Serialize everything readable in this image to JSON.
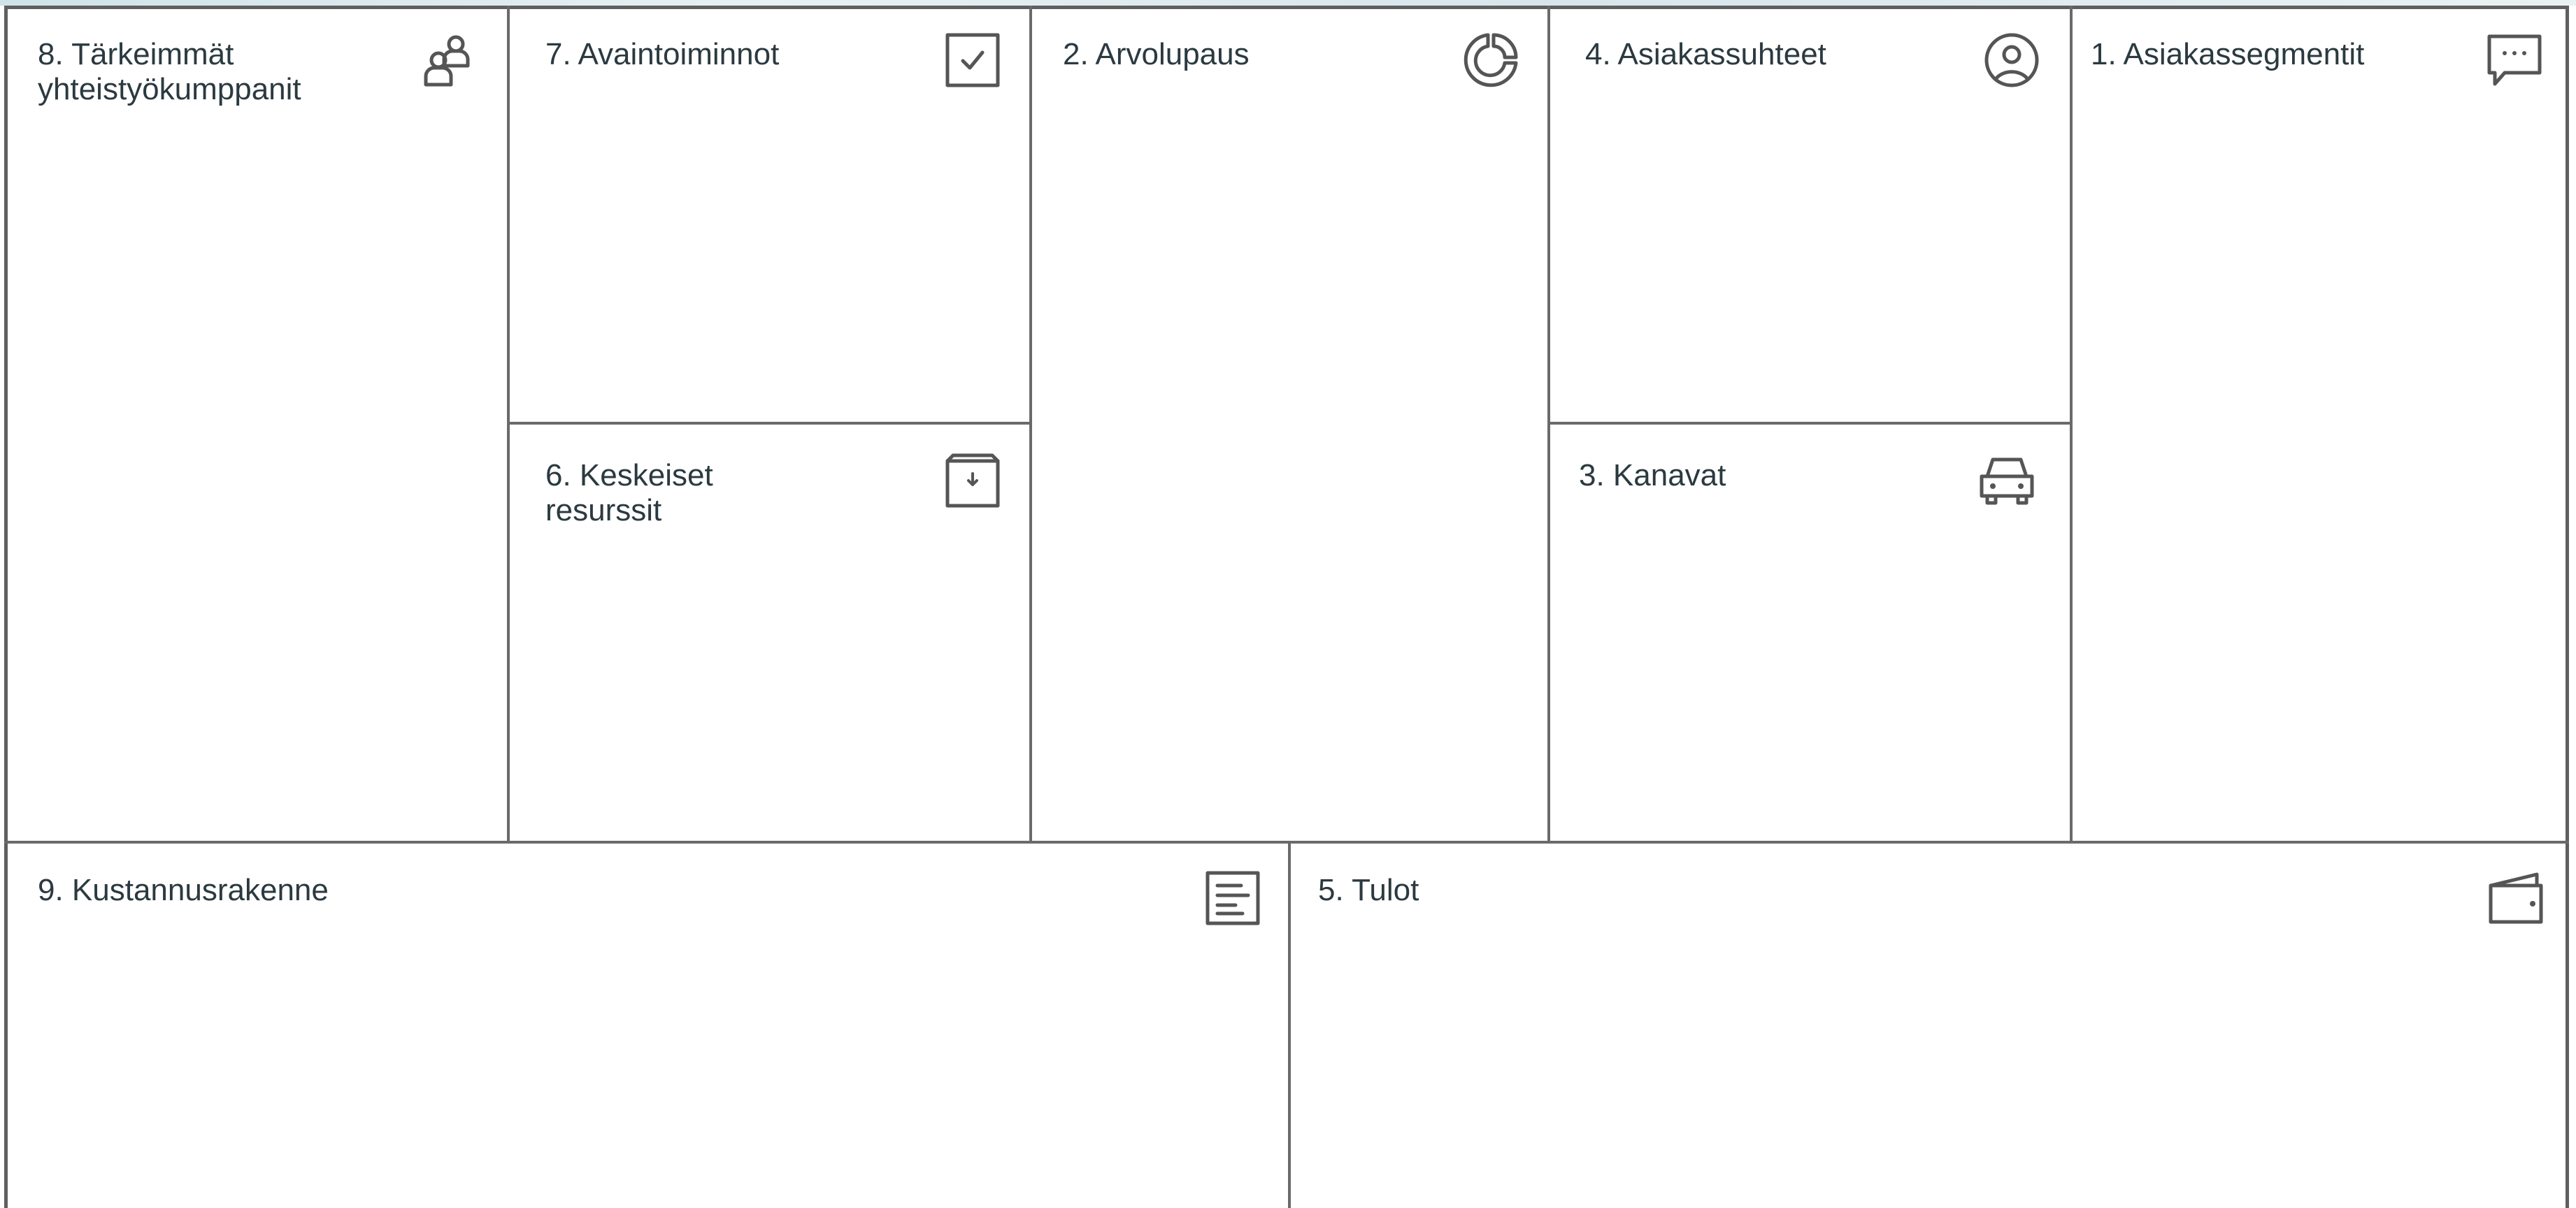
{
  "canvas": {
    "blocks": {
      "key_partners": {
        "label": "8. Tärkeimmät\nyhteistyökumppanit",
        "icon": "partners-icon"
      },
      "key_activities": {
        "label": "7. Avaintoiminnot",
        "icon": "checkbox-icon"
      },
      "key_resources": {
        "label": "6. Keskeiset\nresurssit",
        "icon": "archive-box-icon"
      },
      "value_proposition": {
        "label": "2. Arvolupaus",
        "icon": "pie-chart-icon"
      },
      "customer_relationships": {
        "label": "4. Asiakassuhteet",
        "icon": "user-circle-icon"
      },
      "channels": {
        "label": "3. Kanavat",
        "icon": "car-icon"
      },
      "customer_segments": {
        "label": "1. Asiakassegmentit",
        "icon": "chat-bubble-icon"
      },
      "cost_structure": {
        "label": "9. Kustannusrakenne",
        "icon": "document-lines-icon"
      },
      "revenue_streams": {
        "label": "5. Tulot",
        "icon": "wallet-icon"
      }
    },
    "colors": {
      "line": "#6a6a6a",
      "frame": "#5f5f5f",
      "text": "#2b3a40",
      "icon": "#555555"
    }
  }
}
